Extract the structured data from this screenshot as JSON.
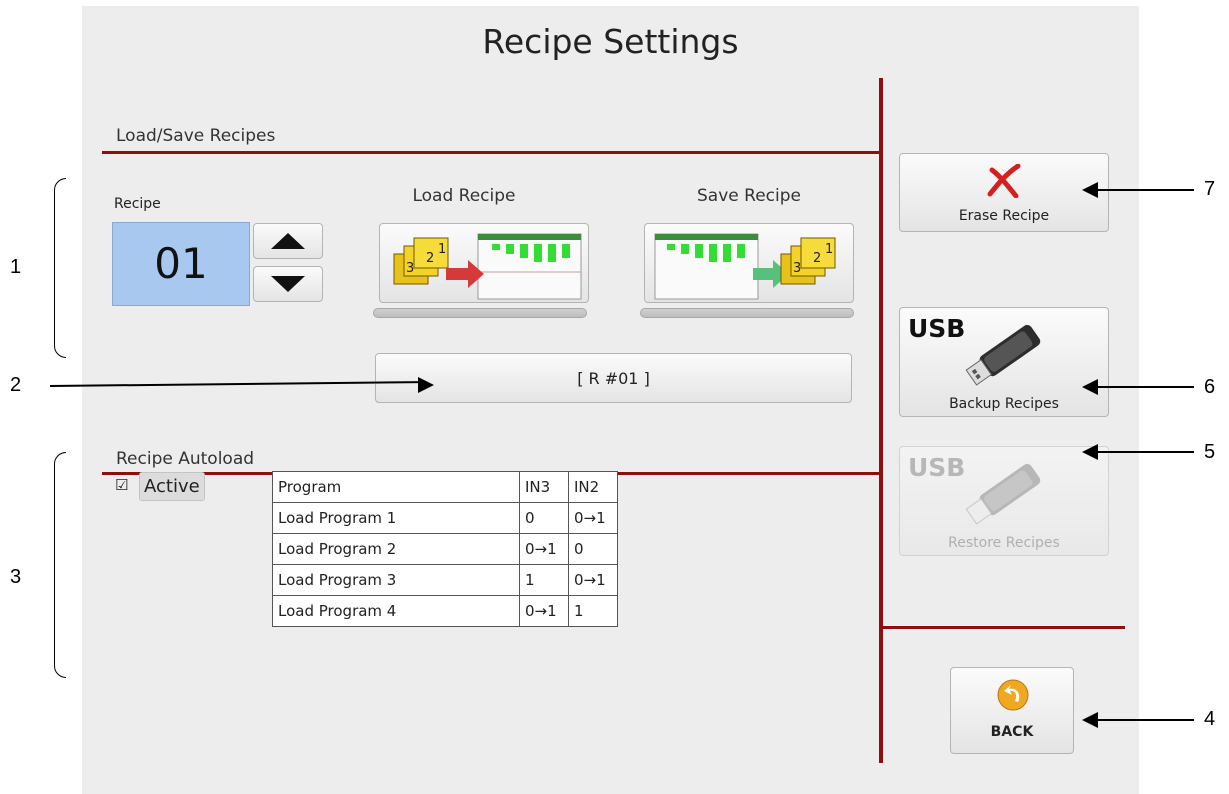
{
  "title": "Recipe Settings",
  "load_save": {
    "section_title": "Load/Save Recipes",
    "recipe_label": "Recipe",
    "recipe_value": "01",
    "load_label": "Load Recipe",
    "save_label": "Save Recipe",
    "recipe_name": "[ R #01 ]"
  },
  "autoload": {
    "section_title": "Recipe Autoload",
    "active_label": "Active",
    "active_checked": true,
    "table": {
      "headers": [
        "Program",
        "IN3",
        "IN2"
      ],
      "rows": [
        [
          "Load Program 1",
          "0",
          "0→1"
        ],
        [
          "Load Program 2",
          "0→1",
          "0"
        ],
        [
          "Load Program 3",
          "1",
          "0→1"
        ],
        [
          "Load Program 4",
          "0→1",
          "1"
        ]
      ]
    }
  },
  "side": {
    "erase_label": "Erase Recipe",
    "usb_text": "USB",
    "backup_label": "Backup Recipes",
    "restore_label": "Restore Recipes",
    "back_label": "BACK"
  },
  "annotations": {
    "n1": "1",
    "n2": "2",
    "n3": "3",
    "n4": "4",
    "n5": "5",
    "n6": "6",
    "n7": "7"
  },
  "colors": {
    "accent_line": "#8b1010",
    "recipe_box": "#a9c8ef",
    "erase_x": "#d42020"
  }
}
